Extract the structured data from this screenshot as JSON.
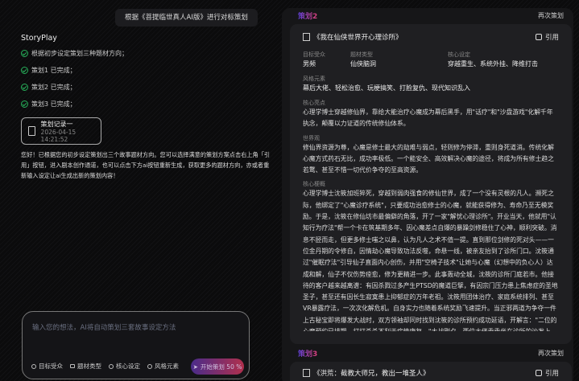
{
  "user_message": "根据《菩提临世真人AI版》进行对标策划",
  "bot": {
    "name": "StoryPlay",
    "steps": [
      "根据初步设定策划三种题材方向；",
      "策划1 已完成；",
      "策划2 已完成；",
      "策划3 已完成；"
    ],
    "record": {
      "title": "策划记录一",
      "time": "2026-04-15 14:21:52"
    },
    "reply": "您好！已根据您的初步设定策划出三个故事题材方向。您可以选择满意的策划方案点击右上角「引用」按钮，进入剧本创作通道，也可以点击下方ai按钮重新生成，获取更多的题材方向，亦或者重新输入设定让ai生成出新的策划内容！"
  },
  "input": {
    "placeholder": "输入您的想法，AI将自动策划三套故事设定方法",
    "chips": [
      "目标受众",
      "题材类型",
      "核心设定",
      "风格元素"
    ],
    "start_label": "开始策划 50 %"
  },
  "plans": [
    {
      "label": "策划2",
      "again": "再次策划",
      "title": "《我在仙侠世界开心理诊所》",
      "cite": "引用",
      "fields": {
        "audience_label": "目标受众",
        "audience": "男频",
        "genre_label": "题材类型",
        "genre": "仙侠脑洞",
        "core_label": "核心设定",
        "core": "穿越重生、系统外挂、降维打击",
        "style_label": "风格元素",
        "style": "幕后大佬、轻松治愈、玩梗搞笑、打脸复仇、现代知识乱入",
        "highlight_label": "核心亮点",
        "highlight": "心理学博士穿越修仙界，靠给大能治疗心魔成为幕后黑手，用\"话疗\"和\"沙盘游戏\"化解千年执念，颠覆以力证道的传统修仙体系。",
        "world_label": "世界观",
        "world": "修仙界资源为尊，心魔是修士最大的劫难与弱点，轻则修为停滞，重则身死道消。传统化解心魔方式药石无比，成功率极低。一个能安全、高效解决心魔的途径，将成为所有修士趋之若鹜、甚至不惜一切代价争夺的至高资源。",
        "plot_label": "核心梗概",
        "plot": "心理学博士沈筱加班猝死，穿越到弱肉强食的修仙世界，成了一个没有灵根的凡人。濒死之际，他绑定了\"心魔诊疗系统\"，只要成功治愈修士的心魔，就能获得修为、寿命乃至无模奖励。于是，沈筱在修仙坊市最偏僻的角落，开了一家\"解忧心理诊所\"。开业当天，他就用\"认知行为疗法\"帮一个卡在筑基期多年、因心魔差点自爆的暴躁剑修稳住了心神，顺利突破。消息不胫而走，但更多修士嗤之以鼻，认为凡人之术不值一提。直到那位剑修的死对头——一位金丹期的令修自，因情劫心魔导致功法反噬，命悬一线，被亲友抬到了诊所门口。沈筱通过\"催眠疗法\"引导仙子直面内心创伤，并用\"空椅子技术\"让她与心魔（幻想中的负心人）达成和解，仙子不仅伤势痊愈，修为更精进一步。此事轰动全城，沈筱的诊所门庭若市。他接待的客户越来越离谱：有因杀戮过多产生PTSD的魔道巨擘，有因宗门压力患上焦虑症的圣地圣子，甚至还有因长生寂寞患上抑郁症的万年老祖。沈筱用团体治疗、家庭系统排列、甚至VR暴露疗法，一次次化解危机。自身实力也随着系统奖励飞速提升。当正邪两道为争夺一件上古秘宝即将爆发大战时，双方领袖却同时找到沈筱的诊所预约成功延语，开解言：\"二位的心魔预约已排期，打打杀杀不利于病情康复。\"大战剛夕，两位大佬乖乖坐在诊所的沙发上，对着沈筱哭诉各自的委屈与压力。"
      }
    },
    {
      "label": "策划3",
      "again": "再次策划",
      "title": "《洪荒：截教大师兄，教出一堆圣人》",
      "cite": "引用"
    }
  ]
}
